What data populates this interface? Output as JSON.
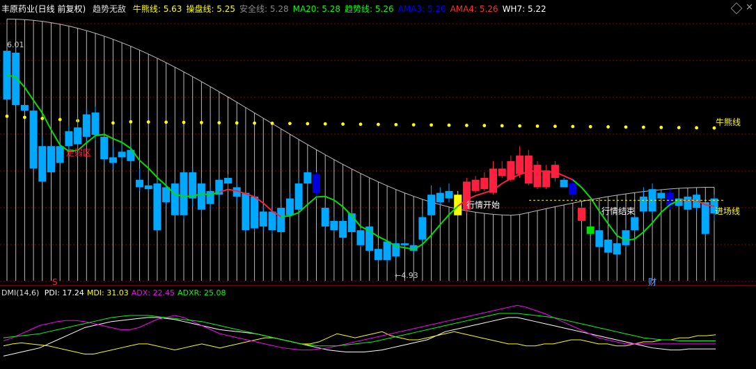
{
  "header": {
    "stock": "丰原药业(日线 前复权)",
    "indicator": "趋势无敌",
    "items": [
      {
        "label": "牛熊线",
        "value": "5.63",
        "color": "#ffff00"
      },
      {
        "label": "操盘线",
        "value": "5.25",
        "color": "#ffff00"
      },
      {
        "label": "安全线",
        "value": "5.28",
        "color": "#888888"
      },
      {
        "label": "MA20",
        "value": "5.28",
        "color": "#00ff00"
      },
      {
        "label": "趋势线",
        "value": "5.26",
        "color": "#00ff00"
      },
      {
        "label": "AMA3",
        "value": "5.26",
        "color": "#0000ff"
      },
      {
        "label": "AMA4",
        "value": "5.26",
        "color": "#ff3030"
      },
      {
        "label": "WH7",
        "value": "5.22",
        "color": "#ffffff"
      }
    ]
  },
  "sub_header": {
    "name": "DMI(14,6)",
    "items": [
      {
        "label": "PDI",
        "value": "17.24",
        "color": "#ffffff"
      },
      {
        "label": "MDI",
        "value": "31.03",
        "color": "#ffff00"
      },
      {
        "label": "ADX",
        "value": "22.45",
        "color": "#ff00ff"
      },
      {
        "label": "ADXR",
        "value": "25.08",
        "color": "#00ff00"
      }
    ]
  },
  "annotations": {
    "high_label": "6.01",
    "low_label": "←4.93",
    "bear_bull_label": "牛熊线",
    "entry_label": "进场线",
    "weak_zone": "走弱区",
    "trend_start": "行情开始",
    "trend_end": "行情结束",
    "cai": "财",
    "s_mark": "S"
  },
  "chart_data": {
    "type": "candlestick",
    "ylim": [
      4.75,
      6.2
    ],
    "candles": [
      [
        6.01,
        5.75,
        6.01,
        5.75,
        "cyan"
      ],
      [
        6.0,
        5.72,
        6.0,
        5.72,
        "cyan"
      ],
      [
        5.72,
        5.69,
        5.72,
        5.69,
        "cyan"
      ],
      [
        5.69,
        5.38,
        5.72,
        5.38,
        "cyan"
      ],
      [
        5.5,
        5.31,
        5.55,
        5.31,
        "cyan"
      ],
      [
        5.5,
        5.36,
        5.5,
        5.36,
        "cyan"
      ],
      [
        5.5,
        5.41,
        5.52,
        5.41,
        "cyan"
      ],
      [
        5.58,
        5.5,
        5.61,
        5.48,
        "cyan"
      ],
      [
        5.6,
        5.51,
        5.65,
        5.48,
        "cyan"
      ],
      [
        5.67,
        5.55,
        5.7,
        5.52,
        "cyan"
      ],
      [
        5.68,
        5.56,
        5.71,
        5.53,
        "cyan"
      ],
      [
        5.55,
        5.43,
        5.58,
        5.4,
        "cyan"
      ],
      [
        5.44,
        5.41,
        5.5,
        5.38,
        "cyan"
      ],
      [
        5.47,
        5.44,
        5.52,
        5.42,
        "cyan"
      ],
      [
        5.48,
        5.42,
        5.52,
        5.4,
        "cyan"
      ],
      [
        5.32,
        5.28,
        5.38,
        5.26,
        "cyan"
      ],
      [
        5.29,
        5.27,
        5.32,
        5.25,
        "cyan"
      ],
      [
        5.3,
        5.05,
        5.32,
        5.05,
        "cyan"
      ],
      [
        5.28,
        5.2,
        5.3,
        5.18,
        "cyan"
      ],
      [
        5.3,
        5.13,
        5.32,
        5.13,
        "cyan"
      ],
      [
        5.36,
        5.13,
        5.36,
        5.11,
        "cyan"
      ],
      [
        5.36,
        5.22,
        5.38,
        5.18,
        "cyan"
      ],
      [
        5.3,
        5.16,
        5.33,
        5.12,
        "cyan"
      ],
      [
        5.26,
        5.19,
        5.28,
        5.16,
        "cyan"
      ],
      [
        5.32,
        5.24,
        5.33,
        5.2,
        "cyan"
      ],
      [
        5.33,
        5.3,
        5.35,
        5.26,
        "cyan"
      ],
      [
        5.28,
        5.23,
        5.3,
        5.2,
        "cyan"
      ],
      [
        5.25,
        5.05,
        5.25,
        5.04,
        "cyan"
      ],
      [
        5.23,
        5.06,
        5.26,
        5.04,
        "cyan"
      ],
      [
        5.15,
        5.07,
        5.18,
        5.05,
        "cyan"
      ],
      [
        5.15,
        5.05,
        5.16,
        5.03,
        "cyan"
      ],
      [
        5.17,
        5.04,
        5.2,
        5.03,
        "cyan"
      ],
      [
        5.22,
        5.13,
        5.25,
        5.12,
        "cyan"
      ],
      [
        5.3,
        5.16,
        5.33,
        5.16,
        "cyan"
      ],
      [
        5.36,
        5.3,
        5.38,
        5.28,
        "cyan"
      ],
      [
        5.35,
        5.25,
        5.36,
        5.22,
        "blue"
      ],
      [
        5.17,
        5.07,
        5.19,
        5.05,
        "cyan"
      ],
      [
        5.1,
        5.05,
        5.12,
        5.04,
        "cyan"
      ],
      [
        5.1,
        5.01,
        5.12,
        5.0,
        "cyan"
      ],
      [
        5.14,
        5.04,
        5.15,
        5.03,
        "cyan"
      ],
      [
        5.05,
        4.97,
        5.06,
        4.96,
        "cyan"
      ],
      [
        5.07,
        4.94,
        5.07,
        4.94,
        "cyan"
      ],
      [
        4.95,
        4.89,
        4.97,
        4.87,
        "cyan"
      ],
      [
        4.99,
        4.89,
        5.0,
        4.87,
        "cyan"
      ],
      [
        4.98,
        4.91,
        5.0,
        4.9,
        "cyan"
      ],
      [
        4.98,
        4.97,
        5.0,
        4.96,
        "cyan"
      ],
      [
        4.97,
        4.94,
        4.99,
        4.93,
        "cyan"
      ],
      [
        5.12,
        5.0,
        5.14,
        4.98,
        "cyan"
      ],
      [
        5.24,
        5.13,
        5.29,
        5.11,
        "cyan"
      ],
      [
        5.25,
        5.2,
        5.28,
        5.18,
        "cyan"
      ],
      [
        5.26,
        5.22,
        5.3,
        5.2,
        "cyan"
      ],
      [
        5.13,
        5.24,
        5.26,
        5.13,
        "yellow"
      ],
      [
        5.16,
        5.31,
        5.33,
        5.14,
        "red"
      ],
      [
        5.26,
        5.32,
        5.34,
        5.25,
        "red"
      ],
      [
        5.27,
        5.33,
        5.36,
        5.26,
        "red"
      ],
      [
        5.25,
        5.38,
        5.42,
        5.24,
        "red"
      ],
      [
        5.34,
        5.38,
        5.42,
        5.33,
        "red"
      ],
      [
        5.32,
        5.42,
        5.45,
        5.31,
        "red"
      ],
      [
        5.35,
        5.45,
        5.5,
        5.33,
        "red"
      ],
      [
        5.3,
        5.45,
        5.48,
        5.29,
        "red"
      ],
      [
        5.28,
        5.4,
        5.42,
        5.27,
        "red"
      ],
      [
        5.28,
        5.37,
        5.4,
        5.27,
        "red"
      ],
      [
        5.33,
        5.4,
        5.42,
        5.31,
        "red"
      ],
      [
        5.32,
        5.28,
        5.33,
        5.28,
        "cyan"
      ],
      [
        5.3,
        5.24,
        5.33,
        5.22,
        "blue"
      ],
      [
        5.17,
        5.1,
        5.18,
        5.1,
        "red"
      ],
      [
        5.07,
        5.03,
        5.08,
        5.03,
        "green"
      ],
      [
        5.05,
        4.96,
        5.07,
        4.95,
        "cyan"
      ],
      [
        5.0,
        4.93,
        5.02,
        4.92,
        "cyan"
      ],
      [
        4.98,
        4.92,
        4.99,
        4.9,
        "cyan"
      ],
      [
        5.05,
        4.97,
        5.06,
        4.96,
        "cyan"
      ],
      [
        5.12,
        5.05,
        5.14,
        5.04,
        "cyan"
      ],
      [
        5.23,
        5.15,
        5.28,
        5.14,
        "cyan"
      ],
      [
        5.27,
        5.15,
        5.3,
        5.13,
        "cyan"
      ],
      [
        5.25,
        5.22,
        5.27,
        5.2,
        "cyan"
      ],
      [
        5.25,
        5.18,
        5.27,
        5.16,
        "blue"
      ],
      [
        5.22,
        5.18,
        5.24,
        5.17,
        "cyan"
      ],
      [
        5.23,
        5.16,
        5.25,
        5.15,
        "cyan"
      ],
      [
        5.24,
        5.17,
        5.26,
        5.15,
        "cyan"
      ],
      [
        5.2,
        5.03,
        5.21,
        5.01,
        "cyan"
      ],
      [
        5.22,
        5.14,
        5.24,
        5.1,
        "cyan"
      ]
    ],
    "pdi": [
      10,
      12,
      14,
      16,
      18,
      22,
      26,
      30,
      34,
      38,
      40,
      42,
      44,
      45,
      46,
      47,
      48,
      48,
      47,
      46,
      44,
      42,
      40,
      38,
      36,
      35,
      34,
      33,
      32,
      30,
      28,
      26,
      24,
      22,
      20,
      18,
      16,
      15,
      14,
      14,
      14,
      15,
      16,
      18,
      20,
      22,
      24,
      26,
      30,
      34,
      36,
      38,
      40,
      42,
      44,
      46,
      48,
      48,
      46,
      44,
      42,
      40,
      38,
      36,
      34,
      32,
      30,
      28,
      26,
      24,
      22,
      20,
      18,
      17,
      16,
      16,
      17,
      17,
      17,
      17
    ],
    "mdi": [
      20,
      22,
      23,
      22,
      21,
      20,
      18,
      16,
      14,
      12,
      12,
      14,
      16,
      18,
      20,
      22,
      22,
      20,
      18,
      16,
      18,
      20,
      22,
      20,
      18,
      20,
      22,
      24,
      26,
      28,
      28,
      26,
      24,
      22,
      22,
      24,
      28,
      32,
      30,
      28,
      30,
      32,
      34,
      30,
      28,
      26,
      26,
      28,
      30,
      32,
      34,
      32,
      30,
      28,
      26,
      24,
      22,
      22,
      20,
      20,
      22,
      22,
      24,
      26,
      26,
      24,
      22,
      22,
      20,
      20,
      22,
      24,
      24,
      26,
      26,
      28,
      28,
      30,
      30,
      31
    ],
    "adx": [
      25,
      28,
      32,
      36,
      40,
      42,
      44,
      45,
      45,
      44,
      42,
      40,
      38,
      36,
      36,
      38,
      42,
      46,
      48,
      50,
      48,
      44,
      40,
      36,
      32,
      30,
      28,
      26,
      24,
      22,
      20,
      18,
      17,
      16,
      16,
      17,
      18,
      20,
      22,
      24,
      26,
      28,
      30,
      32,
      34,
      36,
      38,
      40,
      42,
      44,
      46,
      48,
      50,
      52,
      54,
      56,
      58,
      60,
      58,
      55,
      52,
      48,
      44,
      40,
      36,
      32,
      28,
      26,
      24,
      22,
      22,
      22,
      22,
      22,
      22,
      22,
      22,
      22,
      22,
      22
    ],
    "adxr": [
      28,
      29,
      30,
      31,
      32,
      34,
      36,
      38,
      40,
      42,
      44,
      46,
      48,
      49,
      50,
      50,
      50,
      49,
      48,
      47,
      46,
      45,
      44,
      42,
      40,
      38,
      36,
      34,
      32,
      30,
      28,
      26,
      24,
      22,
      21,
      20,
      20,
      20,
      21,
      22,
      23,
      24,
      26,
      28,
      30,
      32,
      34,
      36,
      38,
      40,
      42,
      44,
      46,
      48,
      50,
      52,
      52,
      52,
      51,
      50,
      49,
      48,
      46,
      44,
      42,
      40,
      38,
      36,
      34,
      32,
      30,
      28,
      27,
      26,
      26,
      25,
      25,
      25,
      25,
      25
    ]
  },
  "colors": {
    "cyan": "#00a8ff",
    "blue": "#0000e0",
    "red": "#ff2040",
    "yellow": "#ffff00",
    "green": "#00e000",
    "grid": "#8b0000"
  }
}
